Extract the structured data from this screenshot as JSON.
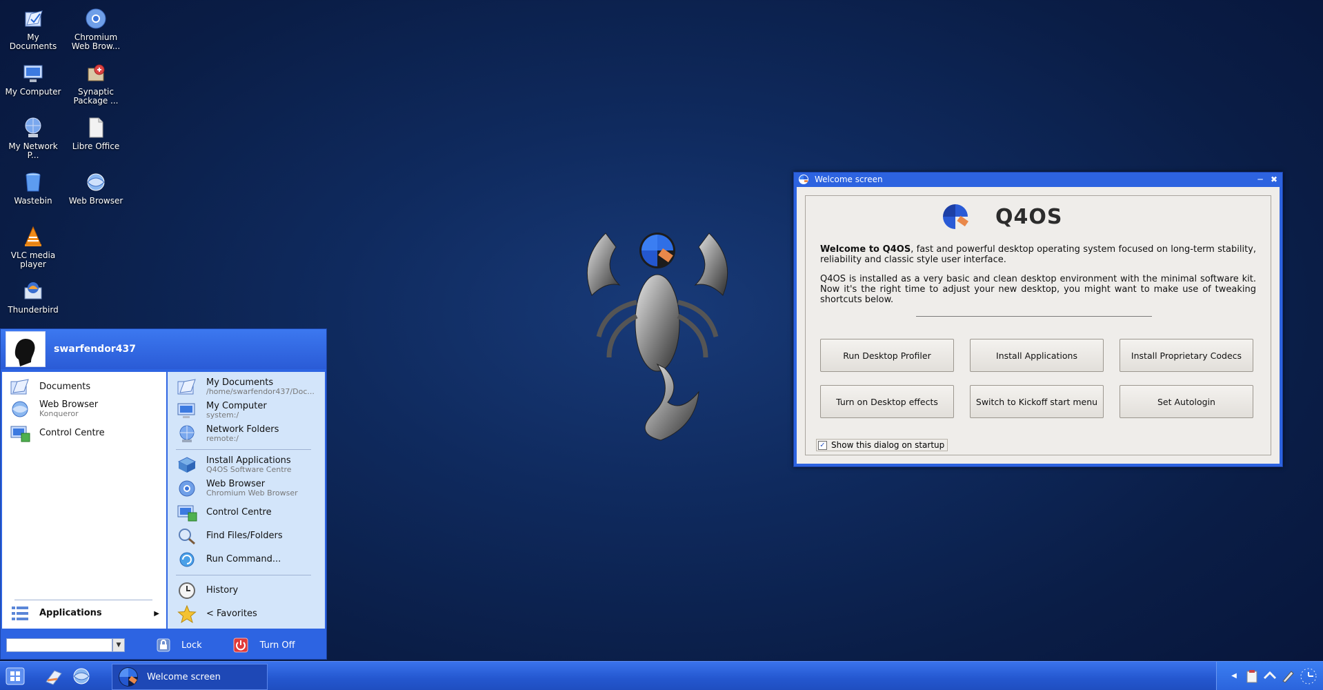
{
  "desktop": {
    "icons": [
      {
        "label": "My Documents",
        "icon": "documents-icon"
      },
      {
        "label": "Chromium Web Brow...",
        "icon": "chromium-icon"
      },
      {
        "label": "My Computer",
        "icon": "computer-icon"
      },
      {
        "label": "Synaptic Package ...",
        "icon": "synaptic-icon"
      },
      {
        "label": "My Network P...",
        "icon": "network-icon"
      },
      {
        "label": "Libre Office",
        "icon": "file-icon"
      },
      {
        "label": "Wastebin",
        "icon": "trash-icon"
      },
      {
        "label": "Web Browser",
        "icon": "web-browser-icon"
      },
      {
        "label": "VLC media player",
        "icon": "vlc-icon"
      },
      {
        "label": "Thunderbird",
        "icon": "thunderbird-icon"
      }
    ]
  },
  "welcome": {
    "window_title": "Welcome screen",
    "brand": "Q4OS",
    "para1_bold": "Welcome to Q4OS",
    "para1_rest": ", fast and powerful desktop operating system focused on long-term stability, reliability and classic style user interface.",
    "para2": "Q4OS is installed as a very basic and clean desktop environment with the minimal software kit. Now it's the right time to adjust your new desktop, you might want to make use of tweaking shortcuts below.",
    "buttons": {
      "run_profiler": "Run Desktop Profiler",
      "install_apps": "Install Applications",
      "install_codecs": "Install Proprietary Codecs",
      "desktop_effects": "Turn on Desktop effects",
      "kickoff": "Switch to Kickoff start menu",
      "autologin": "Set Autologin"
    },
    "show_on_startup_label": "Show this dialog on startup",
    "show_on_startup_checked": true
  },
  "start_menu": {
    "username": "swarfendor437",
    "left_items": [
      {
        "label": "Documents",
        "sub": ""
      },
      {
        "label": "Web Browser",
        "sub": "Konqueror"
      },
      {
        "label": "Control Centre",
        "sub": ""
      }
    ],
    "applications_label": "Applications",
    "right_items": [
      {
        "label": "My Documents",
        "sub": "/home/swarfendor437/Doc..."
      },
      {
        "label": "My Computer",
        "sub": "system:/"
      },
      {
        "label": "Network Folders",
        "sub": "remote:/"
      },
      {
        "label": "Install Applications",
        "sub": "Q4OS Software Centre"
      },
      {
        "label": "Web Browser",
        "sub": "Chromium Web Browser"
      },
      {
        "label": "Control Centre",
        "sub": ""
      },
      {
        "label": "Find Files/Folders",
        "sub": ""
      },
      {
        "label": "Run Command...",
        "sub": ""
      },
      {
        "label": "History",
        "sub": ""
      },
      {
        "label": "< Favorites",
        "sub": ""
      }
    ],
    "lock_label": "Lock",
    "turn_off_label": "Turn Off"
  },
  "taskbar": {
    "task_welcome_label": "Welcome screen"
  },
  "colors": {
    "accent": "#2d63e0",
    "desktop_bg": "#0f2a5e"
  }
}
